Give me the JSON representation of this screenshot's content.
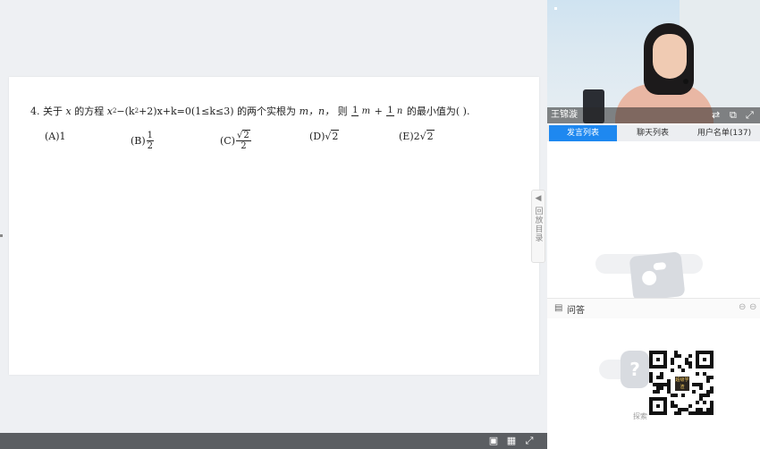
{
  "question": {
    "number": "4.",
    "text_prefix": "关于",
    "var_x": "x",
    "text_eq_label": "的方程",
    "equation_a": "x",
    "equation_b": "−(k",
    "equation_c": "+2)x+k=0(1≤k≤3)",
    "text_mid": "的两个实根为",
    "roots": "m，n，",
    "text_then": "则",
    "frac1_num": "1",
    "frac1_den": "m",
    "plus": "+",
    "frac2_num": "1",
    "frac2_den": "n",
    "text_tail": "的最小值为(        )."
  },
  "options": [
    {
      "label": "(A)",
      "value": "1"
    },
    {
      "label": "(B)",
      "num": "1",
      "den": "2"
    },
    {
      "label": "(C)",
      "num_rad": "2",
      "den": "2"
    },
    {
      "label": "(D)",
      "rad": "2"
    },
    {
      "label": "(E)",
      "coef": "2",
      "rad": "2"
    }
  ],
  "side_handle": {
    "label": "回放目录"
  },
  "video": {
    "presenter_name": "王锦漩"
  },
  "tabs": [
    {
      "label": "发言列表",
      "active": true
    },
    {
      "label": "聊天列表",
      "active": false
    },
    {
      "label": "用户名单(137)",
      "active": false
    }
  ],
  "qa": {
    "title": "问答",
    "hint": "探索"
  },
  "qr": {
    "center_text": "超级学渣"
  },
  "colors": {
    "accent": "#1e88f0",
    "bottom_bar": "#5b5e62"
  }
}
